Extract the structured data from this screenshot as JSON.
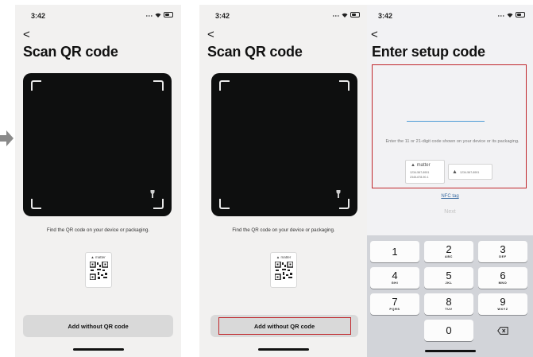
{
  "screens": [
    {
      "status": {
        "time": "3:42"
      },
      "back": "<",
      "title": "Scan QR code",
      "hint": "Find the QR code on your device or packaging.",
      "qr_card_label": "matter",
      "add_button": "Add without QR code"
    },
    {
      "status": {
        "time": "3:42"
      },
      "back": "<",
      "title": "Scan QR code",
      "hint": "Find the QR code on your device or packaging.",
      "qr_card_label": "matter",
      "add_button": "Add without QR code",
      "highlight": "add-without-qr-button"
    },
    {
      "status": {
        "time": "3:42"
      },
      "back": "<",
      "title": "Enter setup code",
      "setup_hint": "Enter the 11 or 21-digit code shown on your device or its packaging.",
      "card1": {
        "logo": "matter",
        "lines": [
          "1234-567-8901",
          "2345-678-90-1"
        ]
      },
      "card2": {
        "code": "1234-567-8901"
      },
      "nfc_link": "NFC tag",
      "next_button": "Next",
      "highlight": "setup-code-area",
      "keypad": [
        {
          "digit": "1",
          "letters": ""
        },
        {
          "digit": "2",
          "letters": "ABC"
        },
        {
          "digit": "3",
          "letters": "DEF"
        },
        {
          "digit": "4",
          "letters": "GHI"
        },
        {
          "digit": "5",
          "letters": "JKL"
        },
        {
          "digit": "6",
          "letters": "MNO"
        },
        {
          "digit": "7",
          "letters": "PQRS"
        },
        {
          "digit": "8",
          "letters": "TUV"
        },
        {
          "digit": "9",
          "letters": "WXYZ"
        },
        {
          "digit": "0",
          "letters": ""
        }
      ]
    }
  ],
  "colors": {
    "highlight": "#c0262b",
    "link": "#3d6ea3",
    "code_line": "#4c9bd6"
  },
  "icons": [
    "arrow-right-icon",
    "wifi-icon",
    "battery-icon",
    "torch-icon",
    "qr-icon",
    "delete-key-icon"
  ]
}
